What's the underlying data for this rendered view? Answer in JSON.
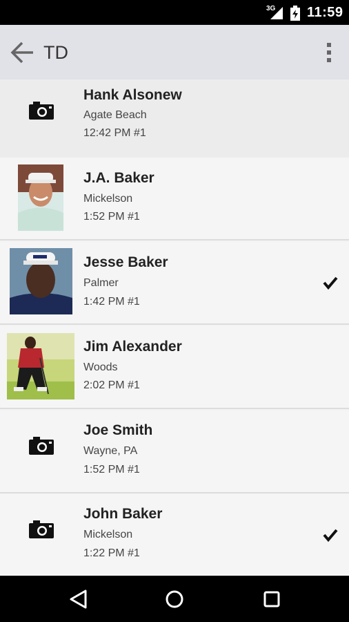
{
  "status_bar": {
    "network": "3G",
    "time": "11:59"
  },
  "app_bar": {
    "title": "TD",
    "back_icon": "arrow-back-icon",
    "menu_icon": "overflow-menu-icon"
  },
  "contacts": [
    {
      "name": "Hank Alsonew",
      "location": "Agate Beach",
      "meta": "12:42 PM #1",
      "avatar": "camera-icon",
      "checked": false
    },
    {
      "name": "J.A. Baker",
      "location": "Mickelson",
      "meta": "1:52 PM #1",
      "avatar": "photo",
      "checked": false
    },
    {
      "name": "Jesse Baker",
      "location": "Palmer",
      "meta": "1:42 PM #1",
      "avatar": "photo",
      "checked": true
    },
    {
      "name": "Jim Alexander",
      "location": "Woods",
      "meta": "2:02 PM #1",
      "avatar": "photo",
      "checked": false
    },
    {
      "name": "Joe Smith",
      "location": "Wayne, PA",
      "meta": "1:52 PM #1",
      "avatar": "camera-icon",
      "checked": false
    },
    {
      "name": "John Baker",
      "location": "Mickelson",
      "meta": "1:22 PM #1",
      "avatar": "camera-icon",
      "checked": true
    }
  ],
  "nav_bar": {
    "back": "nav-back-icon",
    "home": "nav-home-icon",
    "recents": "nav-recents-icon"
  }
}
